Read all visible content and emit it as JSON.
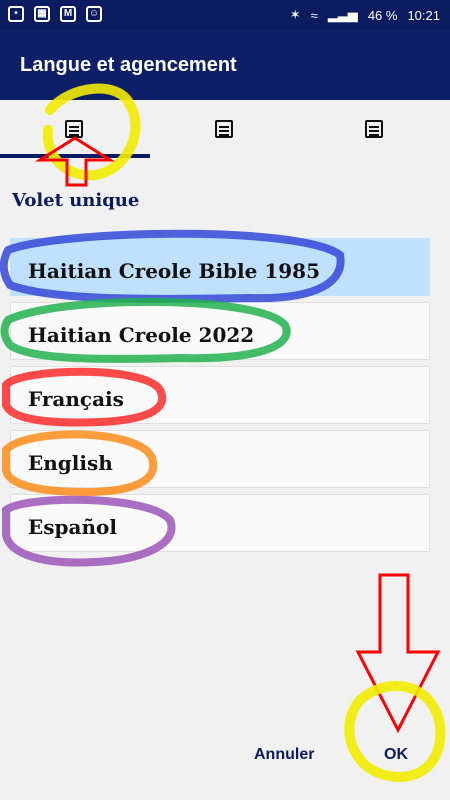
{
  "status": {
    "battery": "46 %",
    "time": "10:21",
    "icons": [
      "app-icon",
      "image-icon",
      "mail-icon",
      "android-icon",
      "bluetooth-icon",
      "wifi-icon",
      "signal-icon",
      "battery-icon"
    ]
  },
  "appbar": {
    "title": "Langue et agencement"
  },
  "tabs": [
    {
      "icon": "single-pane-icon",
      "active": true
    },
    {
      "icon": "split-pane-icon",
      "active": false
    },
    {
      "icon": "list-pane-icon",
      "active": false
    }
  ],
  "section": {
    "title": "Volet unique"
  },
  "languages": [
    {
      "label": "Haitian Creole Bible 1985",
      "selected": true
    },
    {
      "label": "Haitian Creole 2022",
      "selected": false
    },
    {
      "label": "Français",
      "selected": false
    },
    {
      "label": "English",
      "selected": false
    },
    {
      "label": "Español",
      "selected": false
    }
  ],
  "buttons": {
    "cancel": "Annuler",
    "ok": "OK"
  },
  "colors": {
    "appbar": "#0d1f66",
    "statusbar": "#0b1b5f",
    "selected_row": "#bfe0ff",
    "accent_text": "#0b1b5f"
  }
}
